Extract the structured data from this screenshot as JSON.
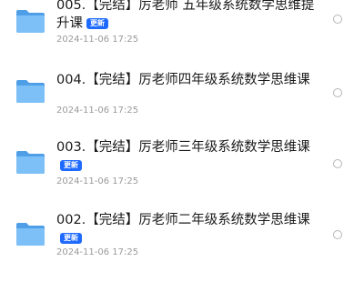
{
  "files": [
    {
      "title": "005.【完结】厉老师 五年级系统数学思维提升课",
      "badge": "更新",
      "date": "2024-11-06 17:25"
    },
    {
      "title": "004.【完结】厉老师四年级系统数学思维课",
      "badge": "",
      "date": "2024-11-06 17:25"
    },
    {
      "title": "003.【完结】厉老师三年级系统数学思维课",
      "badge": "更新",
      "date": "2024-11-06 17:25"
    },
    {
      "title": "002.【完结】厉老师二年级系统数学思维课",
      "badge": "更新",
      "date": "2024-11-06 17:25"
    }
  ],
  "colors": {
    "folder": "#5aa9f0",
    "badge": "#1f6bff",
    "date": "#9a9a9a"
  },
  "icons": {
    "folder": "folder-icon",
    "select": "radio-unchecked"
  }
}
